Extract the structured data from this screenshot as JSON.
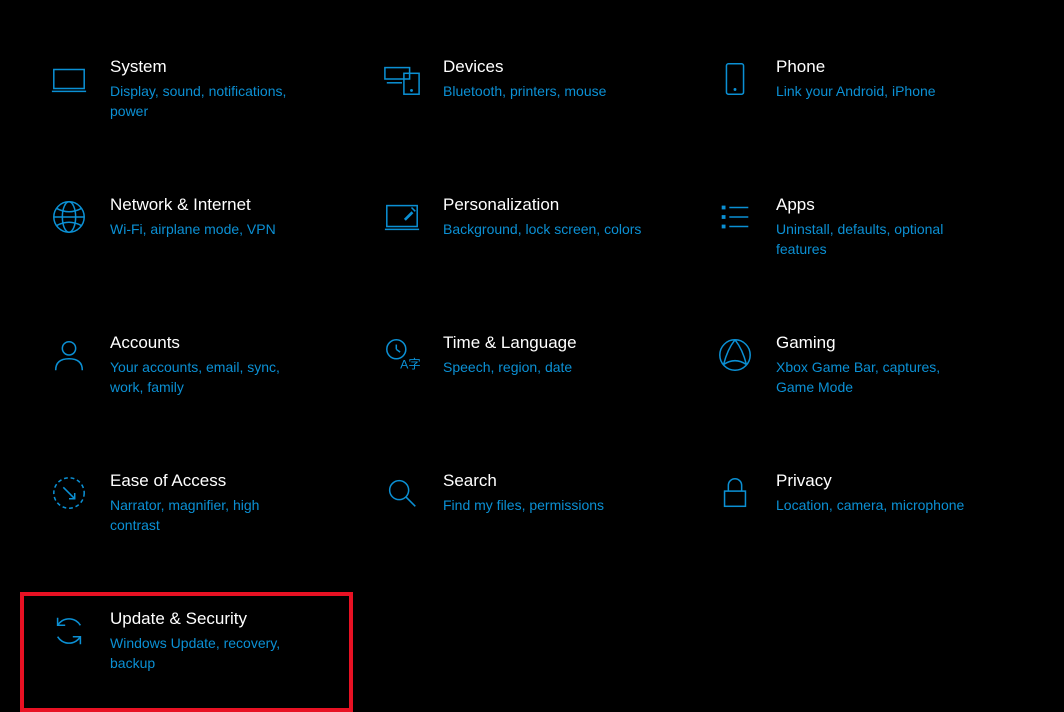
{
  "colors": {
    "accent": "#0b90d4",
    "highlight": "#e81123",
    "bg": "#000000",
    "text": "#ffffff"
  },
  "tiles": {
    "system": {
      "title": "System",
      "desc": "Display, sound, notifications, power",
      "icon": "system-icon"
    },
    "devices": {
      "title": "Devices",
      "desc": "Bluetooth, printers, mouse",
      "icon": "devices-icon"
    },
    "phone": {
      "title": "Phone",
      "desc": "Link your Android, iPhone",
      "icon": "phone-icon"
    },
    "network": {
      "title": "Network & Internet",
      "desc": "Wi-Fi, airplane mode, VPN",
      "icon": "globe-icon"
    },
    "personalization": {
      "title": "Personalization",
      "desc": "Background, lock screen, colors",
      "icon": "personalization-icon"
    },
    "apps": {
      "title": "Apps",
      "desc": "Uninstall, defaults, optional features",
      "icon": "apps-icon"
    },
    "accounts": {
      "title": "Accounts",
      "desc": "Your accounts, email, sync, work, family",
      "icon": "person-icon"
    },
    "time": {
      "title": "Time & Language",
      "desc": "Speech, region, date",
      "icon": "time-language-icon"
    },
    "gaming": {
      "title": "Gaming",
      "desc": "Xbox Game Bar, captures, Game Mode",
      "icon": "gaming-icon"
    },
    "ease": {
      "title": "Ease of Access",
      "desc": "Narrator, magnifier, high contrast",
      "icon": "ease-of-access-icon"
    },
    "search": {
      "title": "Search",
      "desc": "Find my files, permissions",
      "icon": "search-icon"
    },
    "privacy": {
      "title": "Privacy",
      "desc": "Location, camera, microphone",
      "icon": "lock-icon"
    },
    "update": {
      "title": "Update & Security",
      "desc": "Windows Update, recovery, backup",
      "icon": "update-icon",
      "highlighted": true
    }
  }
}
